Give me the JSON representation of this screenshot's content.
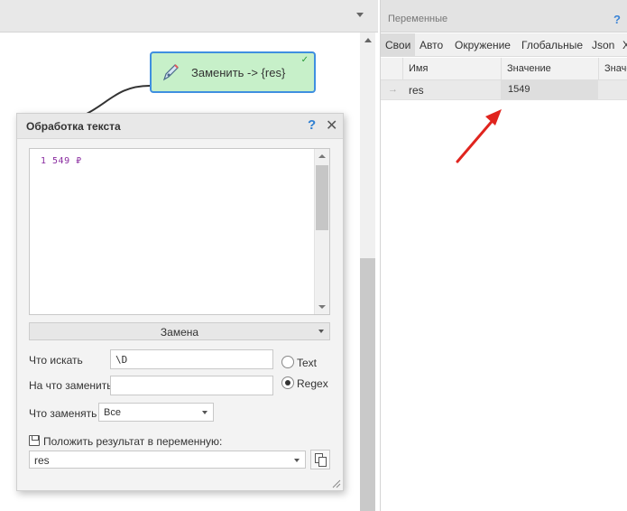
{
  "canvas": {
    "node": {
      "label": "Заменить -> {res}",
      "check_mark": "✓",
      "icon": "pen-icon"
    }
  },
  "dialog": {
    "title": "Обработка текста",
    "help": "?",
    "close": "✕",
    "text_content": "1 549 ₽",
    "mode": "Замена",
    "find_label": "Что искать",
    "find_value": "\\D",
    "replace_with_label": "На что заменить",
    "replace_with_value": "",
    "radio_text": "Text",
    "radio_regex": "Regex",
    "radio_selected": "Regex",
    "what_replace_label": "Что заменять",
    "what_replace_value": "Все",
    "save_result_label": "Положить результат в переменную:",
    "save_result_value": "res"
  },
  "variables_panel": {
    "title": "Переменные",
    "help": "?",
    "tabs": [
      "Свои",
      "Авто",
      "Окружение",
      "Глобальные",
      "Json",
      "X"
    ],
    "active_tab": "Свои",
    "columns": [
      "Имя",
      "Значение",
      "Значе"
    ],
    "rows": [
      {
        "name": "res",
        "value": "1549"
      }
    ]
  },
  "colors": {
    "node_fill": "#c7f0c9",
    "node_border": "#3f8fe0",
    "accent_blue": "#2f7fd1",
    "annotation_arrow": "#e0241e",
    "monospace_text": "#8a2ca0"
  }
}
